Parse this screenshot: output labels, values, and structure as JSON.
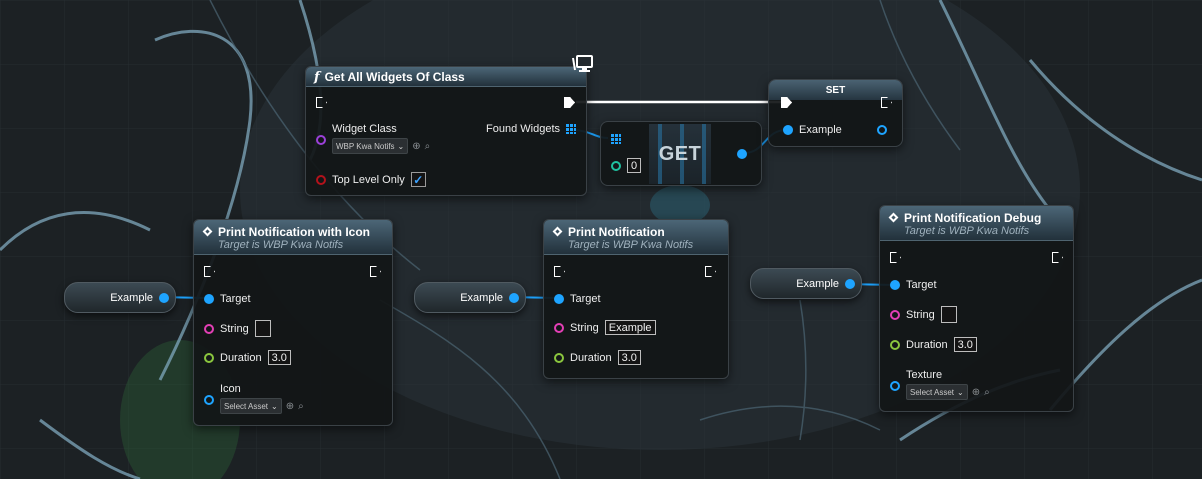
{
  "nodes": {
    "get_all_widgets": {
      "title": "Get All Widgets Of Class",
      "widget_class_label": "Widget Class",
      "widget_class_value": "WBP Kwa Notifs",
      "found_widgets_label": "Found Widgets",
      "top_level_only_label": "Top Level Only",
      "top_level_only_checked": true
    },
    "get": {
      "title": "GET",
      "index_value": "0"
    },
    "set": {
      "title": "SET",
      "variable_label": "Example"
    },
    "print_with_icon": {
      "title": "Print Notification with Icon",
      "subtitle": "Target is WBP Kwa Notifs",
      "target_label": "Target",
      "string_label": "String",
      "string_value": "",
      "duration_label": "Duration",
      "duration_value": "3.0",
      "icon_label": "Icon",
      "icon_value": "Select Asset"
    },
    "print": {
      "title": "Print Notification",
      "subtitle": "Target is WBP Kwa Notifs",
      "target_label": "Target",
      "string_label": "String",
      "string_value": "Example",
      "duration_label": "Duration",
      "duration_value": "3.0"
    },
    "print_debug": {
      "title": "Print Notification Debug",
      "subtitle": "Target is WBP Kwa Notifs",
      "target_label": "Target",
      "string_label": "String",
      "string_value": "",
      "duration_label": "Duration",
      "duration_value": "3.0",
      "texture_label": "Texture",
      "texture_value": "Select Asset"
    }
  },
  "variables": [
    {
      "name": "Example"
    },
    {
      "name": "Example"
    },
    {
      "name": "Example"
    }
  ],
  "icons": {
    "function": "f",
    "check": "✓",
    "chevron": "⌄",
    "browse": "⊕",
    "search": "⌕"
  },
  "colors": {
    "object_pin": "#1ea4ff",
    "string_pin": "#e33fb5",
    "float_pin": "#8bc63e",
    "bool_pin": "#b3121b",
    "class_pin": "#9b40d8",
    "int_pin": "#1fc2a0",
    "exec_wire": "#ffffff"
  }
}
